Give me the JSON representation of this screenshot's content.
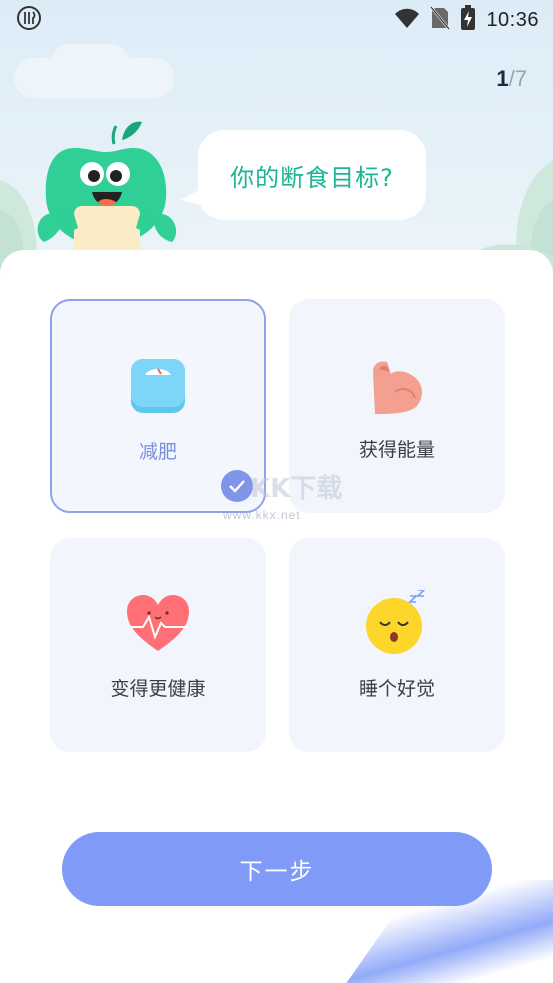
{
  "status_bar": {
    "left_icon": "restaurant-icon",
    "icons": [
      "wifi-icon",
      "no-sim-icon",
      "battery-charging-icon"
    ],
    "time": "10:36"
  },
  "progress": {
    "current": "1",
    "separator": "/",
    "total": "7"
  },
  "header": {
    "mascot_icon": "apple-mascot-icon",
    "question": "你的断食目标?"
  },
  "options": [
    {
      "label": "减肥",
      "icon": "scale-icon",
      "selected": true
    },
    {
      "label": "获得能量",
      "icon": "flexed-bicep-icon",
      "selected": false
    },
    {
      "label": "变得更健康",
      "icon": "heartbeat-icon",
      "selected": false
    },
    {
      "label": "睡个好觉",
      "icon": "sleeping-face-icon",
      "selected": false
    }
  ],
  "watermark": {
    "main": "KK下载",
    "sub": "www.kkx.net"
  },
  "next_button": {
    "label": "下一步"
  },
  "colors": {
    "accent": "#7f9bf7",
    "selected_border": "#8ea2ee",
    "question_text": "#1db593",
    "option_bg": "#f2f5fc"
  }
}
